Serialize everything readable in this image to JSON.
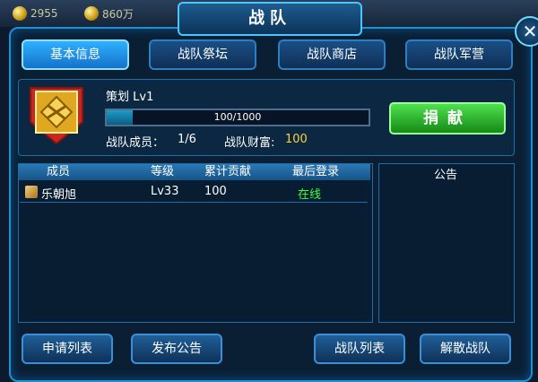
{
  "topbar": {
    "gold": "2955",
    "coins": "860万"
  },
  "title": "战队",
  "tabs": [
    {
      "label": "基本信息",
      "active": true
    },
    {
      "label": "战队祭坛",
      "active": false
    },
    {
      "label": "战队商店",
      "active": false
    },
    {
      "label": "战队军营",
      "active": false
    }
  ],
  "team": {
    "name": "策划 Lv1",
    "progress_text": "100/1000",
    "progress": 0.1,
    "members_label": "战队成员：",
    "members_value": "1/6",
    "wealth_label": "战队财富:",
    "wealth_value": "100",
    "donate_label": "捐献"
  },
  "table": {
    "headers": [
      "成员",
      "等级",
      "累计贡献",
      "最后登录"
    ],
    "rows": [
      {
        "name": "乐朝旭",
        "level": "Lv33",
        "contribution": "100",
        "status": "在线"
      }
    ]
  },
  "notice": {
    "title": "公告"
  },
  "buttons": {
    "apply_list": "申请列表",
    "post_notice": "发布公告",
    "team_list": "战队列表",
    "disband": "解散战队"
  },
  "colors": {
    "accent": "#2fb0ff",
    "online": "#3cff3c",
    "wealth": "#ffd33c",
    "donate": "#2cc02c"
  }
}
